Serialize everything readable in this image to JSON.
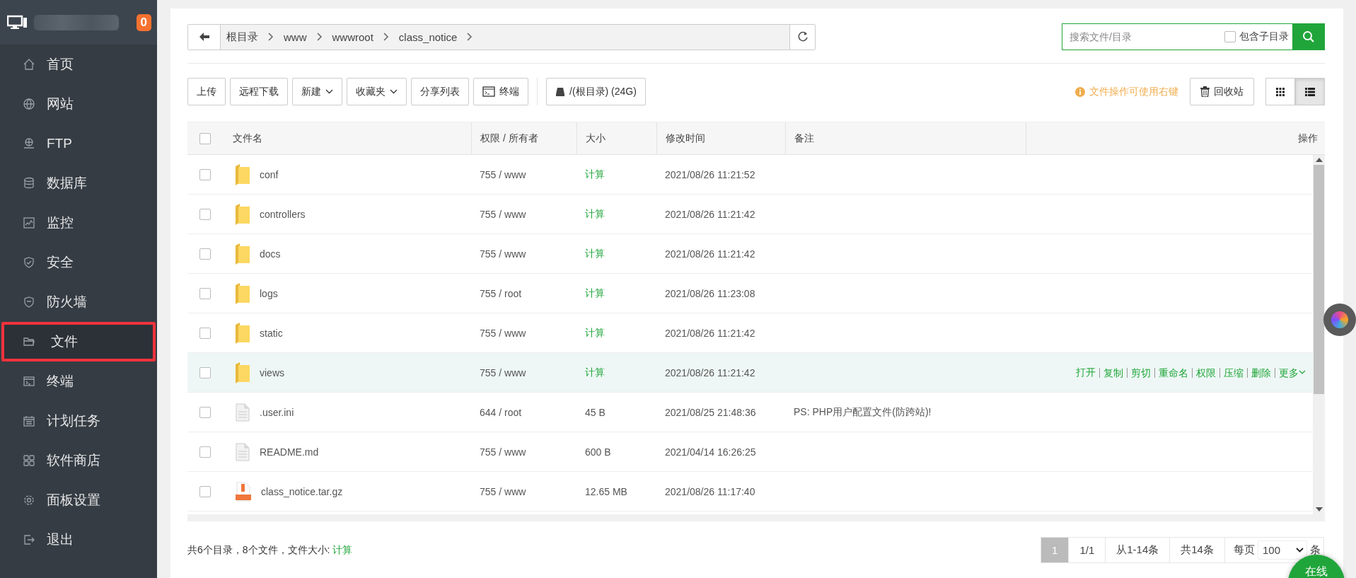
{
  "sidebar": {
    "badge": "0",
    "items": [
      {
        "label": "首页",
        "selected": false,
        "highlighted": false
      },
      {
        "label": "网站",
        "selected": false,
        "highlighted": false
      },
      {
        "label": "FTP",
        "selected": false,
        "highlighted": false
      },
      {
        "label": "数据库",
        "selected": false,
        "highlighted": false
      },
      {
        "label": "监控",
        "selected": false,
        "highlighted": false
      },
      {
        "label": "安全",
        "selected": false,
        "highlighted": false
      },
      {
        "label": "防火墙",
        "selected": false,
        "highlighted": false
      },
      {
        "label": "文件",
        "selected": true,
        "highlighted": true
      },
      {
        "label": "终端",
        "selected": false,
        "highlighted": false
      },
      {
        "label": "计划任务",
        "selected": false,
        "highlighted": false
      },
      {
        "label": "软件商店",
        "selected": false,
        "highlighted": false
      },
      {
        "label": "面板设置",
        "selected": false,
        "highlighted": false
      },
      {
        "label": "退出",
        "selected": false,
        "highlighted": false
      }
    ]
  },
  "breadcrumb": [
    "根目录",
    "www",
    "wwwroot",
    "class_notice"
  ],
  "search": {
    "placeholder": "搜索文件/目录",
    "include_subdirs": {
      "label": "包含子目录",
      "checked": false
    }
  },
  "toolbar": {
    "buttons": [
      {
        "label": "上传",
        "kind": "plain"
      },
      {
        "label": "远程下载",
        "kind": "plain"
      },
      {
        "label": "新建",
        "kind": "dropdown"
      },
      {
        "label": "收藏夹",
        "kind": "dropdown"
      },
      {
        "label": "分享列表",
        "kind": "plain"
      },
      {
        "label": "终端",
        "kind": "terminal"
      },
      {
        "label": "/(根目录) (24G)",
        "kind": "disk"
      }
    ],
    "hint": "文件操作可使用右键",
    "recycle": "回收站",
    "views": [
      {
        "kind": "grid",
        "selected": false
      },
      {
        "kind": "list",
        "selected": true
      }
    ]
  },
  "table": {
    "all_checked": false,
    "columns": [
      "文件名",
      "权限 / 所有者",
      "大小",
      "修改时间",
      "备注",
      "操作"
    ],
    "rows": [
      {
        "kind": "folder",
        "checked": false,
        "name": "conf",
        "perm": "755 / www",
        "size": "计算",
        "size_link": true,
        "mtime": "2021/08/26 11:21:52",
        "highlighted": false
      },
      {
        "kind": "folder",
        "checked": false,
        "name": "controllers",
        "perm": "755 / www",
        "size": "计算",
        "size_link": true,
        "mtime": "2021/08/26 11:21:42",
        "highlighted": false
      },
      {
        "kind": "folder",
        "checked": false,
        "name": "docs",
        "perm": "755 / www",
        "size": "计算",
        "size_link": true,
        "mtime": "2021/08/26 11:21:42",
        "highlighted": false
      },
      {
        "kind": "folder",
        "checked": false,
        "name": "logs",
        "perm": "755 / root",
        "size": "计算",
        "size_link": true,
        "mtime": "2021/08/26 11:23:08",
        "highlighted": false
      },
      {
        "kind": "folder",
        "checked": false,
        "name": "static",
        "perm": "755 / www",
        "size": "计算",
        "size_link": true,
        "mtime": "2021/08/26 11:21:42",
        "highlighted": false
      },
      {
        "kind": "folder",
        "checked": false,
        "name": "views",
        "perm": "755 / www",
        "size": "计算",
        "size_link": true,
        "mtime": "2021/08/26 11:21:42",
        "highlighted": true,
        "actions": [
          "打开",
          "复制",
          "剪切",
          "重命名",
          "权限",
          "压缩",
          "删除",
          "更多"
        ]
      },
      {
        "kind": "file",
        "checked": false,
        "name": ".user.ini",
        "perm": "644 / root",
        "size": "45 B",
        "size_link": false,
        "mtime": "2021/08/25 21:48:36",
        "note": "PS: PHP用户配置文件(防跨站)!",
        "highlighted": false
      },
      {
        "kind": "file",
        "checked": false,
        "name": "README.md",
        "perm": "755 / www",
        "size": "600 B",
        "size_link": false,
        "mtime": "2021/04/14 16:26:25",
        "highlighted": false
      },
      {
        "kind": "archive",
        "checked": false,
        "name": "class_notice.tar.gz",
        "perm": "755 / www",
        "size": "12.65 MB",
        "size_link": false,
        "mtime": "2021/08/26 11:17:40",
        "highlighted": false
      }
    ]
  },
  "summary": {
    "text": "共6个目录，8个文件，文件大小:",
    "link": "计算"
  },
  "pagination": {
    "current": "1",
    "pages": "1/1",
    "range": "从1-14条",
    "total": "共14条",
    "per_page_label": "每页",
    "per_page": "100",
    "unit": "条"
  },
  "online_button": "在线"
}
